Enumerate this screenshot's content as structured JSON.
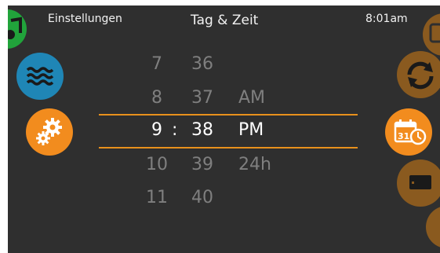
{
  "header": {
    "left_label": "Einstellungen",
    "title": "Tag & Zeit",
    "time": "8:01am"
  },
  "picker": {
    "hours": [
      "7",
      "8",
      "9",
      "10",
      "11"
    ],
    "minutes": [
      "36",
      "37",
      "38",
      "39",
      "40"
    ],
    "separator": ":",
    "periods": [
      "AM",
      "PM",
      "24h"
    ],
    "selected": {
      "hour": "9",
      "minute": "38",
      "period": "PM"
    }
  },
  "icons": {
    "left": [
      "music-icon",
      "water-waves-icon",
      "gears-icon"
    ],
    "right": [
      "partial-icon",
      "rotate-icon",
      "calendar-clock-icon",
      "display-icon",
      "partial-icon"
    ]
  },
  "colors": {
    "background": "#2f2f2f",
    "accent_orange": "#f28c1e",
    "dim_orange": "#8a5a1f",
    "water_blue": "#1f86b6",
    "music_green": "#21a33b",
    "selection_line": "#e8901c",
    "dim_text": "#7f7f7f",
    "text": "#ffffff"
  }
}
